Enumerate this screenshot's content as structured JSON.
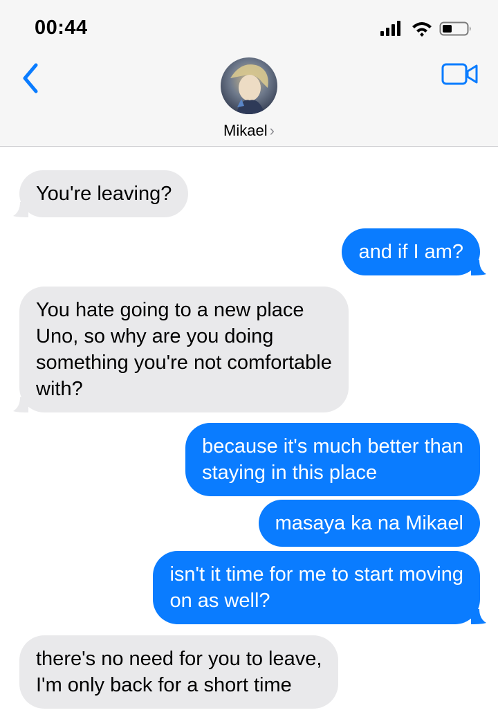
{
  "status_bar": {
    "time": "00:44"
  },
  "header": {
    "contact_name": "Mikael",
    "chevron": "›",
    "back_icon": "chevron-left-icon",
    "video_icon": "video-camera-icon"
  },
  "colors": {
    "accent": "#0a7cff",
    "incoming": "#e9e9eb",
    "header_bg": "#f6f6f6"
  },
  "messages": [
    {
      "sender": "them",
      "text": "You're leaving?"
    },
    {
      "sender": "me",
      "text": "and if I am?"
    },
    {
      "sender": "them",
      "lines": [
        "You hate going to a new place",
        "Uno, so why are you doing",
        "something you're not comfortable",
        "with?"
      ]
    },
    {
      "sender": "me",
      "lines": [
        "because it's much better than",
        "staying in this place"
      ]
    },
    {
      "sender": "me",
      "text": "masaya ka na Mikael"
    },
    {
      "sender": "me",
      "lines": [
        "isn't it time for me to start moving",
        "on as well?"
      ]
    },
    {
      "sender": "them",
      "lines": [
        "there's no need for you to leave,",
        "I'm only back for a short time"
      ]
    }
  ]
}
